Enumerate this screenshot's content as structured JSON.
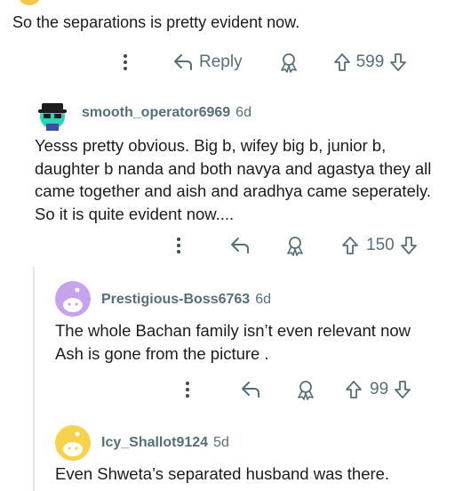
{
  "comments": [
    {
      "text": "So the separations  is pretty evident now.",
      "score": "599",
      "reply_label": "Reply"
    },
    {
      "author": "smooth_operator6969",
      "age": "6d",
      "text": "Yesss pretty obvious. Big b, wifey big b, junior b, daughter b nanda and both navya and agastya they all came together and aish and aradhya came seperately. So it is quite evident now....",
      "score": "150"
    },
    {
      "author": "Prestigious-Boss6763",
      "age": "6d",
      "text": "The whole Bachan family isn’t even relevant now Ash is gone from the picture .",
      "score": "99"
    },
    {
      "author": "Icy_Shallot9124",
      "age": "5d",
      "text": "Even Shweta’s separated husband was there."
    }
  ],
  "colors": {
    "text": "#1c1c1c",
    "meta": "#576f76",
    "thread_line": "#e5e5e5",
    "avatar_green": "#2fd3b6",
    "avatar_purple": "#c7a3ef",
    "avatar_yellow": "#f7d24d"
  }
}
